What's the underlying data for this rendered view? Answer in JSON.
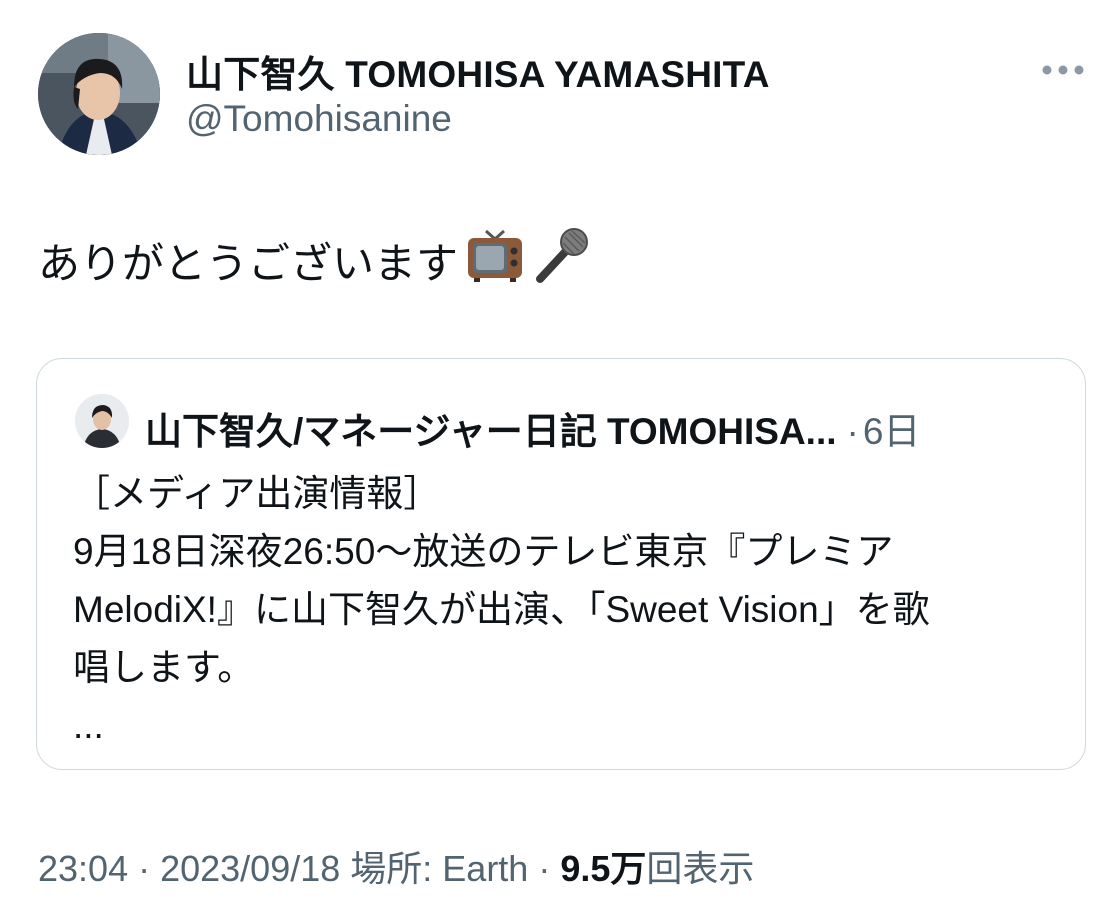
{
  "author": {
    "name": "山下智久 TOMOHISA YAMASHITA",
    "handle": "@Tomohisanine"
  },
  "tweet": {
    "text": "ありがとうございます",
    "emojis": [
      "television-emoji",
      "microphone-emoji"
    ]
  },
  "quote": {
    "name": "山下智久/マネージャー日記 TOMOHISA...",
    "separator": "·",
    "time": "6日",
    "lines": [
      "［メディア出演情報］",
      "9月18日深夜26:50〜放送のテレビ東京『プレミア",
      "MelodiX!』に山下智久が出演、「Sweet Vision」を歌",
      "唱します。",
      "..."
    ]
  },
  "meta": {
    "time": "23:04",
    "sep1": " · ",
    "date": "2023/09/18",
    "location": " 場所: Earth",
    "sep2": " · ",
    "views_count": "9.5万",
    "views_label": "回表示"
  },
  "colors": {
    "text_primary": "#0f1419",
    "text_secondary": "#536471",
    "border": "#cfd9de"
  }
}
